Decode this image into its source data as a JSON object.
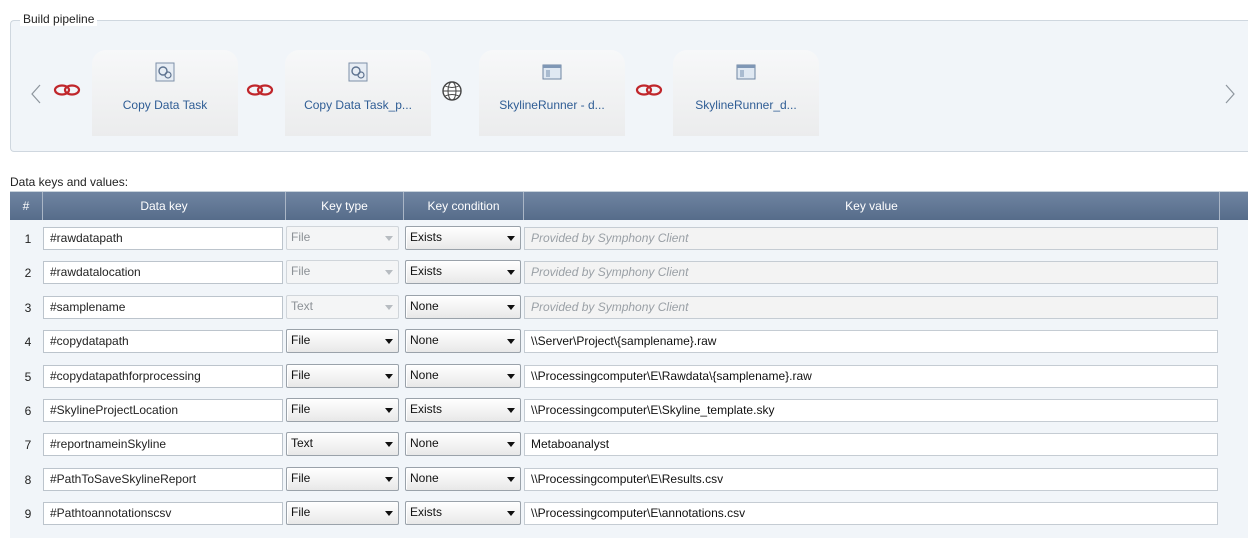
{
  "pipeline": {
    "title": "Build pipeline",
    "steps": [
      {
        "label": "Copy Data Task",
        "icon": "copy-data-task-icon"
      },
      {
        "label": "Copy Data Task_p...",
        "icon": "copy-data-task-icon"
      },
      {
        "label": "SkylineRunner - d...",
        "icon": "window-app-icon"
      },
      {
        "label": "SkylineRunner_d...",
        "icon": "window-app-icon"
      }
    ],
    "connectors": [
      "link-icon",
      "link-icon",
      "globe-icon",
      "link-icon"
    ]
  },
  "table": {
    "caption": "Data keys and values:",
    "headers": {
      "num": "#",
      "key": "Data key",
      "type": "Key type",
      "condition": "Key condition",
      "value": "Key value"
    },
    "rows": [
      {
        "num": "1",
        "key": "#rawdatapath",
        "type": "File",
        "type_enabled": false,
        "condition": "Exists",
        "value": "Provided by Symphony Client",
        "value_enabled": false
      },
      {
        "num": "2",
        "key": "#rawdatalocation",
        "type": "File",
        "type_enabled": false,
        "condition": "Exists",
        "value": "Provided by Symphony Client",
        "value_enabled": false
      },
      {
        "num": "3",
        "key": "#samplename",
        "type": "Text",
        "type_enabled": false,
        "condition": "None",
        "value": "Provided by Symphony Client",
        "value_enabled": false
      },
      {
        "num": "4",
        "key": "#copydatapath",
        "type": "File",
        "type_enabled": true,
        "condition": "None",
        "value": "\\\\Server\\Project\\{samplename}.raw",
        "value_enabled": true
      },
      {
        "num": "5",
        "key": "#copydatapathforprocessing",
        "type": "File",
        "type_enabled": true,
        "condition": "None",
        "value": "\\\\Processingcomputer\\E\\Rawdata\\{samplename}.raw",
        "value_enabled": true
      },
      {
        "num": "6",
        "key": "#SkylineProjectLocation",
        "type": "File",
        "type_enabled": true,
        "condition": "Exists",
        "value": "\\\\Processingcomputer\\E\\Skyline_template.sky",
        "value_enabled": true
      },
      {
        "num": "7",
        "key": "#reportnameinSkyline",
        "type": "Text",
        "type_enabled": true,
        "condition": "None",
        "value": "Metaboanalyst",
        "value_enabled": true
      },
      {
        "num": "8",
        "key": "#PathToSaveSkylineReport",
        "type": "File",
        "type_enabled": true,
        "condition": "None",
        "value": "\\\\Processingcomputer\\E\\Results.csv",
        "value_enabled": true
      },
      {
        "num": "9",
        "key": "#Pathtoannotationscsv",
        "type": "File",
        "type_enabled": true,
        "condition": "Exists",
        "value": "\\\\Processingcomputer\\E\\annotations.csv",
        "value_enabled": true
      }
    ]
  },
  "colors": {
    "header_bg": "#627795",
    "link_accent": "#2f5d95",
    "connector_red": "#c0262b",
    "panel_bg": "#f1f5f9"
  }
}
